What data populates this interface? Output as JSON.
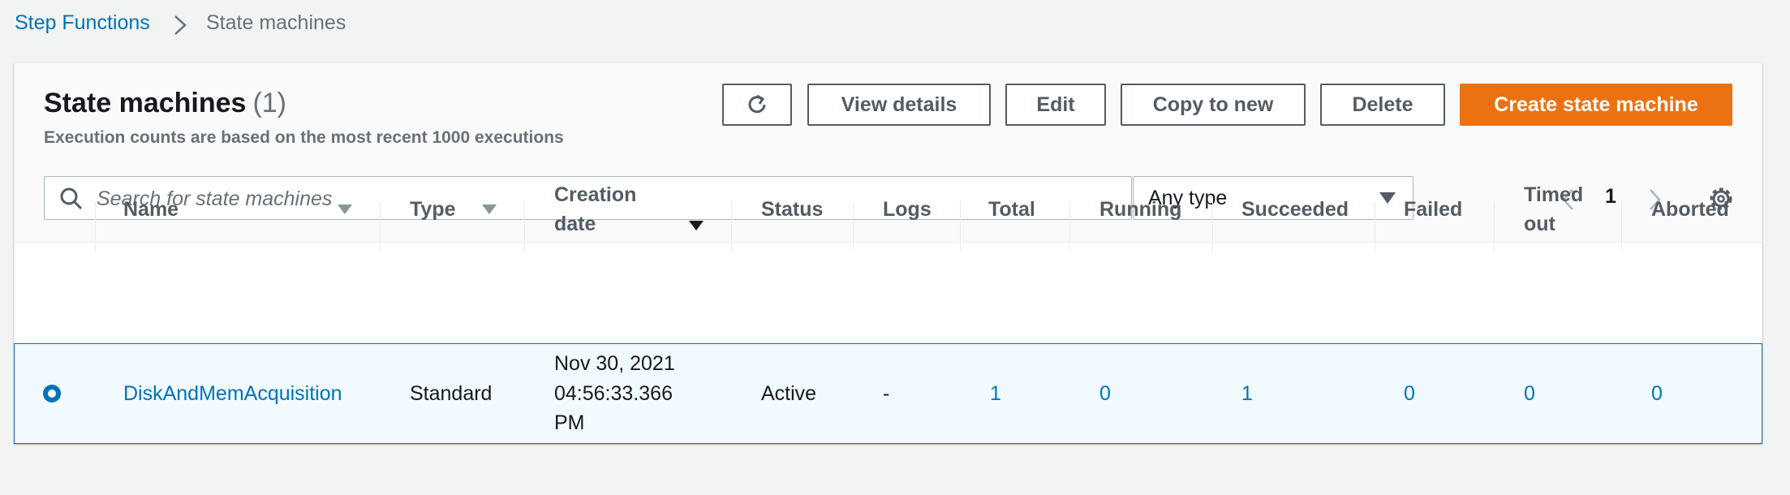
{
  "breadcrumb": {
    "root": "Step Functions",
    "current": "State machines"
  },
  "panel": {
    "title": "State machines",
    "count": "(1)",
    "subtitle": "Execution counts are based on the most recent 1000 executions"
  },
  "toolbar": {
    "refresh_icon": "refresh-icon",
    "view_details": "View details",
    "edit": "Edit",
    "copy_to_new": "Copy to new",
    "delete": "Delete",
    "create": "Create state machine"
  },
  "filter": {
    "search_placeholder": "Search for state machines",
    "type_value": "Any type"
  },
  "pagination": {
    "page": "1"
  },
  "table": {
    "headers": {
      "name": "Name",
      "type": "Type",
      "creation_date_line1": "Creation",
      "creation_date_line2": "date",
      "status": "Status",
      "logs": "Logs",
      "total": "Total",
      "running": "Running",
      "succeeded": "Succeeded",
      "failed": "Failed",
      "timed_out_line1": "Timed",
      "timed_out_line2": "out",
      "aborted": "Aborted"
    },
    "rows": [
      {
        "selected": true,
        "name": "DiskAndMemAcquisition",
        "type": "Standard",
        "creation_line1": "Nov 30, 2021",
        "creation_line2": "04:56:33.366",
        "creation_line3": "PM",
        "status": "Active",
        "logs": "-",
        "total": "1",
        "running": "0",
        "succeeded": "1",
        "failed": "0",
        "timed_out": "0",
        "aborted": "0"
      }
    ]
  },
  "colors": {
    "link": "#0073bb",
    "primary_button": "#ec7211",
    "selected_row_bg": "#f1faff",
    "selected_row_border": "#0073bb"
  }
}
